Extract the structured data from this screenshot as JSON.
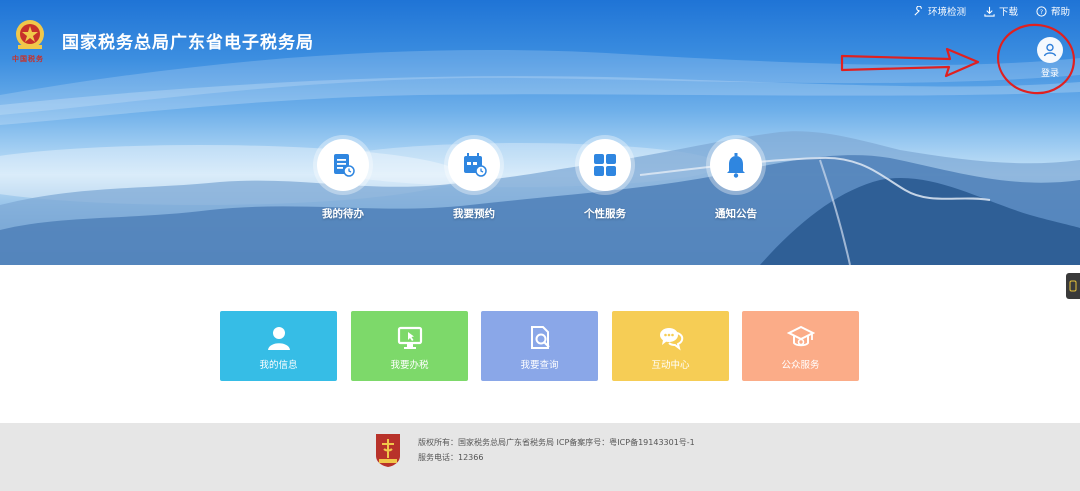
{
  "header": {
    "logo_text": "中国税务",
    "title": "国家税务总局广东省电子税务局",
    "links": [
      {
        "label": "环境检测",
        "icon": "wrench-icon"
      },
      {
        "label": "下载",
        "icon": "download-icon"
      },
      {
        "label": "帮助",
        "icon": "help-icon"
      }
    ],
    "login_label": "登录"
  },
  "quick_actions": [
    {
      "label": "我的待办",
      "icon": "document-clock-icon"
    },
    {
      "label": "我要预约",
      "icon": "calendar-clock-icon"
    },
    {
      "label": "个性服务",
      "icon": "grid-icon"
    },
    {
      "label": "通知公告",
      "icon": "bell-icon"
    }
  ],
  "tiles": [
    {
      "label": "我的信息",
      "icon": "user-icon",
      "color": "#36bde6"
    },
    {
      "label": "我要办税",
      "icon": "monitor-cursor-icon",
      "color": "#7dd96a"
    },
    {
      "label": "我要查询",
      "icon": "document-search-icon",
      "color": "#8aa7e8"
    },
    {
      "label": "互动中心",
      "icon": "chat-icon",
      "color": "#f6cd55"
    },
    {
      "label": "公众服务",
      "icon": "graduation-cap-icon",
      "color": "#fbac88"
    }
  ],
  "footer": {
    "copyright": "版权所有：国家税务总局广东省税务局    ICP备案序号：粤ICP备19143301号-1",
    "phone": "服务电话：12366"
  },
  "colors": {
    "annotation": "#e02020",
    "banner_top": "#1f74d6"
  }
}
